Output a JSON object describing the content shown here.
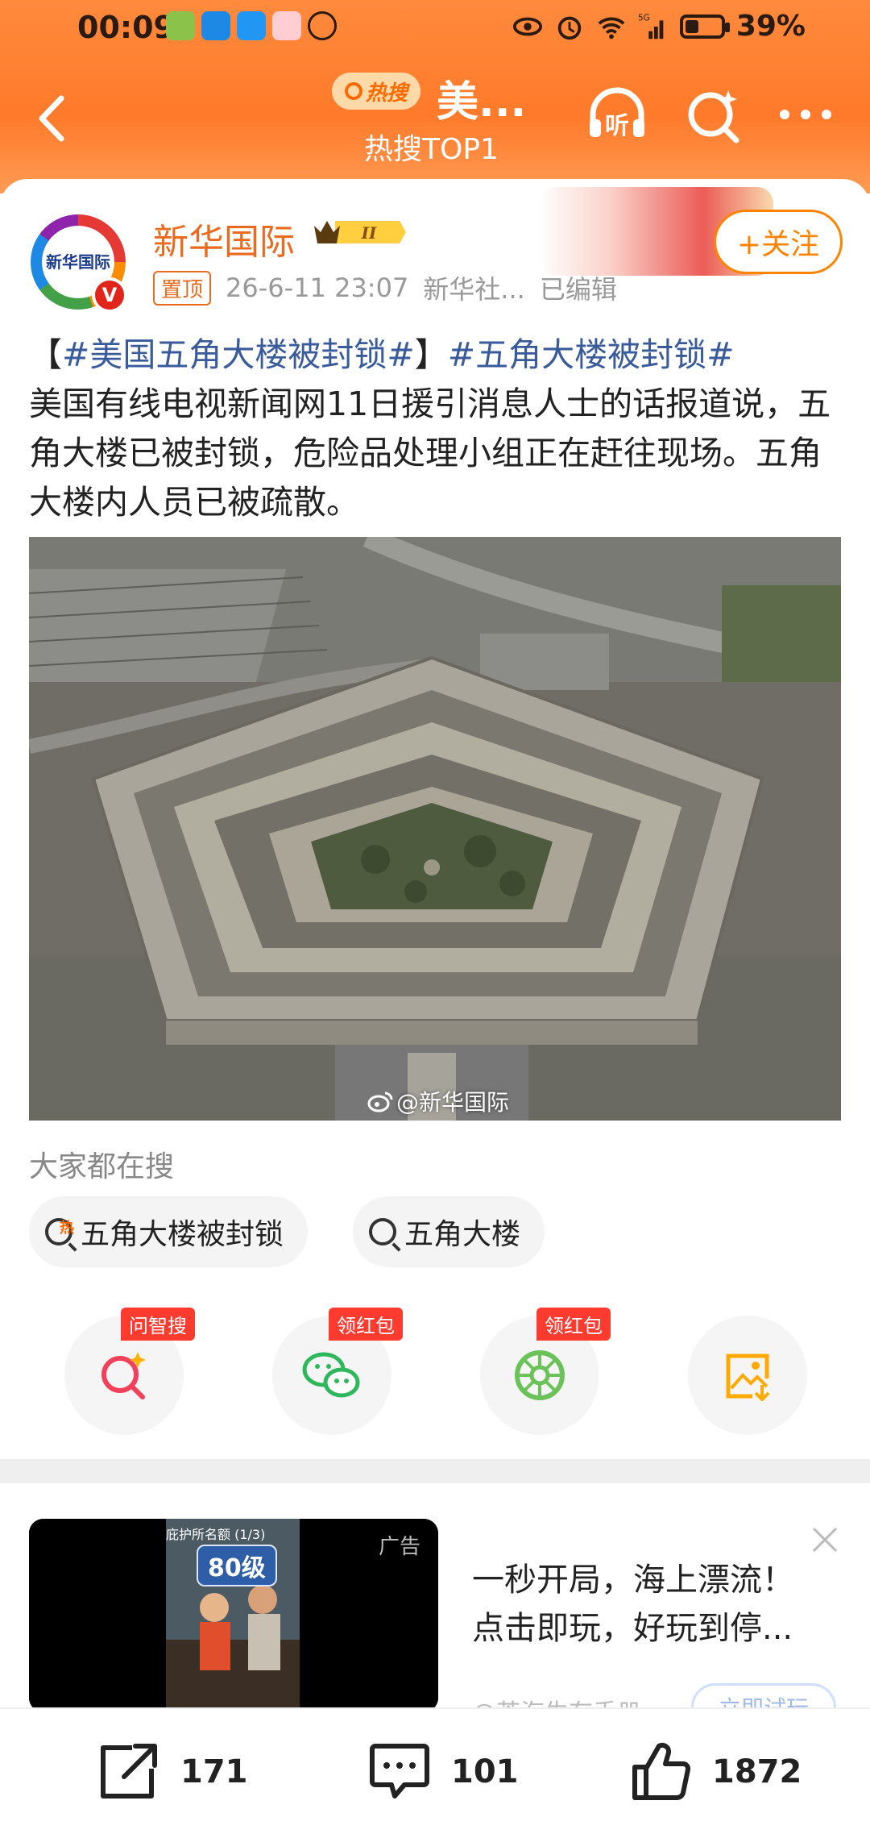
{
  "status_bar": {
    "time": "00:09",
    "battery_percent": "39%",
    "battery_level": 0.39,
    "network": "5G"
  },
  "nav": {
    "hot_badge": "热搜",
    "title": "美...",
    "subtitle": "热搜TOP1",
    "listen_icon_text": "听"
  },
  "post": {
    "author": "新华国际",
    "avatar_text": "新华国际",
    "rank_badge": "II",
    "follow_label": "+关注",
    "pinned_label": "置顶",
    "time": "26-6-11 23:07",
    "source": "新华社...",
    "edited": "已编辑",
    "topic_open": "【",
    "topic1": "#美国五角大楼被封锁#",
    "topic_close": "】",
    "topic2": "#五角大楼被封锁#",
    "body": "美国有线电视新闻网11日援引消息人士的话报道说，五角大楼已被封锁，危险品处理小组正在赶往现场。五角大楼内人员已被疏散。",
    "image_watermark": "@新华国际"
  },
  "search_section": {
    "label": "大家都在搜",
    "chips": [
      {
        "label": "五角大楼被封锁",
        "hot_mark": "热"
      },
      {
        "label": "五角大楼"
      }
    ]
  },
  "share_actions": [
    {
      "icon": "ai-search-icon",
      "tag": "问智搜"
    },
    {
      "icon": "wechat-icon",
      "tag": "领红包"
    },
    {
      "icon": "moments-icon",
      "tag": "领红包"
    },
    {
      "icon": "save-image-icon",
      "tag": ""
    }
  ],
  "ad": {
    "label": "广告",
    "game_title": "庇护所名额 (1/3)",
    "game_level": "80级",
    "line1": "一秒开局，海上漂流！",
    "line2": "点击即玩，好玩到停...",
    "source": "@茶海生存手册",
    "cta": "立即试玩"
  },
  "bottom_bar": {
    "share_count": "171",
    "comment_count": "101",
    "like_count": "1872"
  },
  "colors": {
    "header": "#ff7a2a",
    "accent": "#ff8200",
    "topic": "#3a5b9b",
    "tag_red": "#ff3b30"
  }
}
